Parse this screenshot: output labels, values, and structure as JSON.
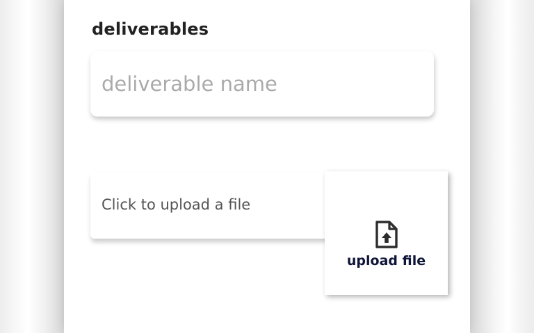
{
  "form": {
    "section_title": "deliverables",
    "deliverable_name": {
      "value": "",
      "placeholder": "deliverable name"
    },
    "file_upload": {
      "prompt": "Click to upload a file",
      "button_label": "upload file",
      "icon": "file-upload-icon"
    }
  },
  "colors": {
    "title_text": "#222222",
    "placeholder_text": "#aaaaaa",
    "upload_label_text": "#0e1538",
    "card_background": "#ffffff",
    "page_background": "#dedede"
  }
}
